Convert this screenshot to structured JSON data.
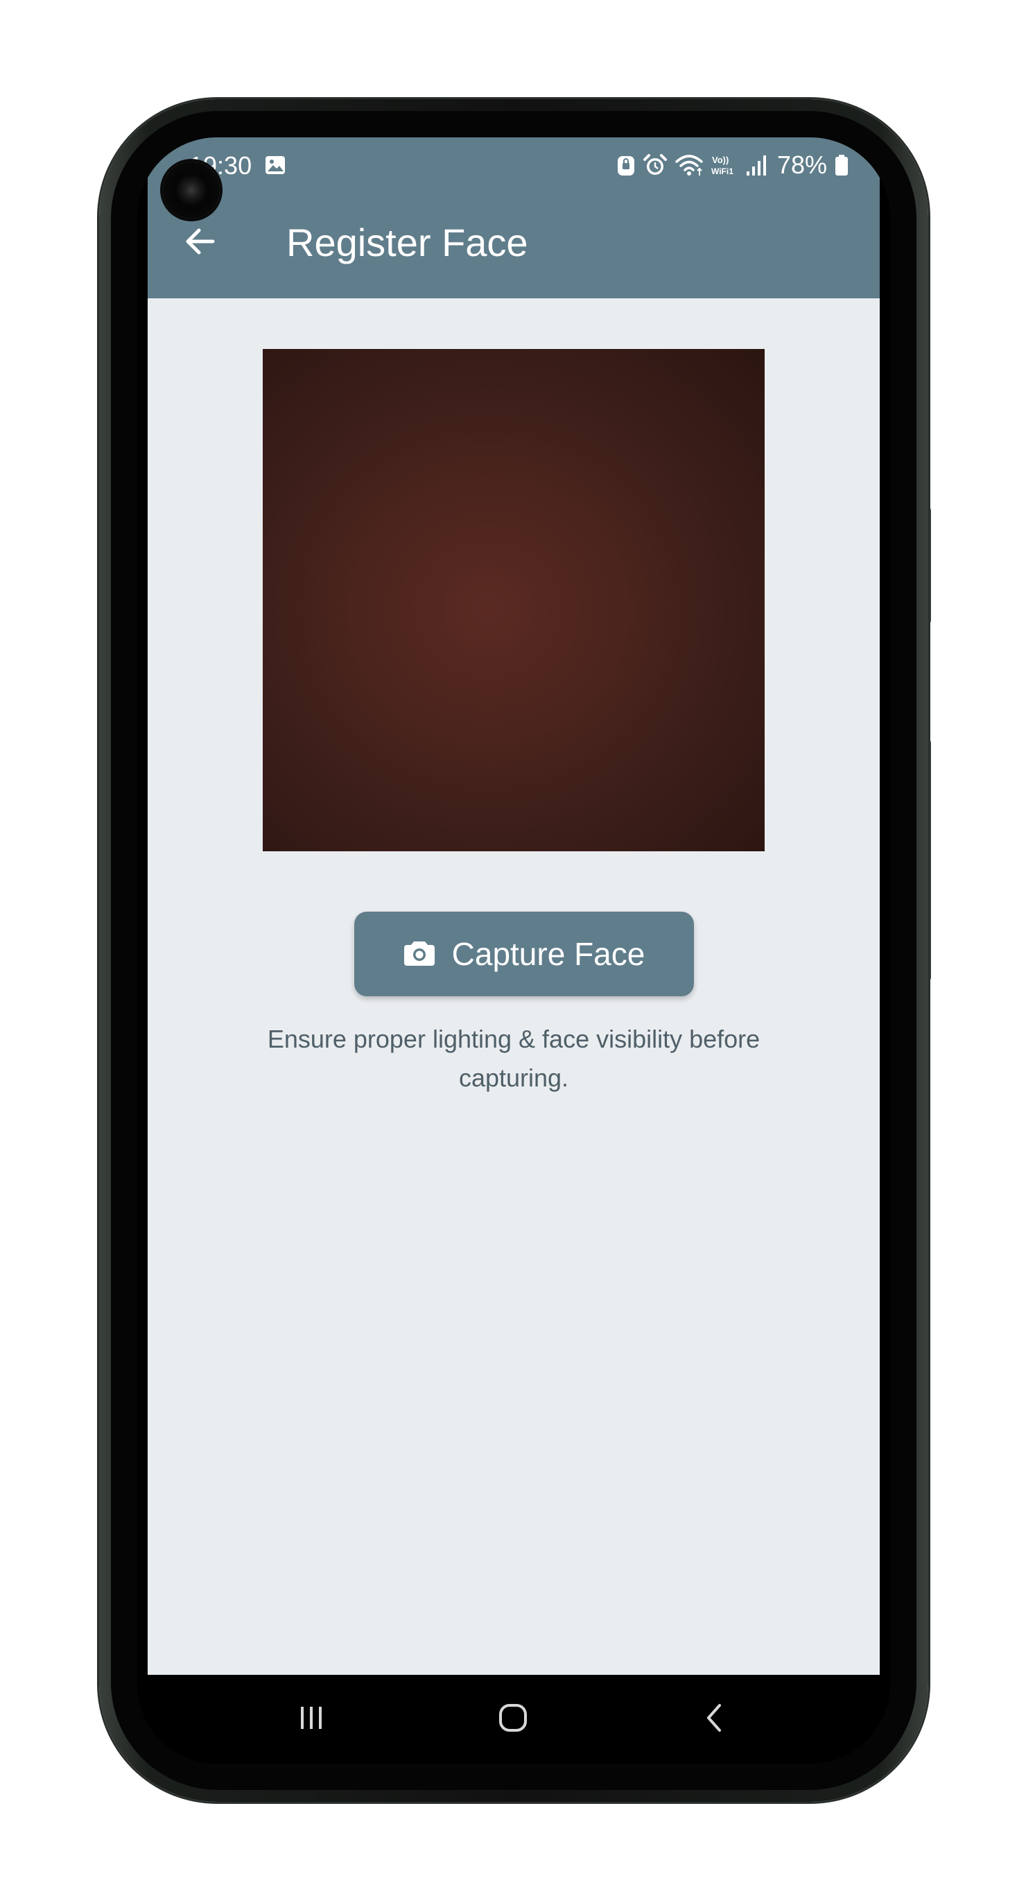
{
  "status_bar": {
    "time": "19:30",
    "battery": "78%",
    "icons": [
      "gallery-icon",
      "vpn-lock-icon",
      "alarm-icon",
      "wifi-icon",
      "volte-wifi-icon",
      "signal-icon",
      "battery-icon"
    ]
  },
  "app_bar": {
    "title": "Register Face",
    "back_icon": "arrow-back-icon"
  },
  "main": {
    "camera_preview": "camera-preview",
    "capture_button_label": "Capture Face",
    "capture_button_icon": "camera-icon",
    "hint_text": "Ensure proper lighting & face visibility before capturing."
  },
  "nav_bar": {
    "buttons": [
      "recent-apps-icon",
      "home-icon",
      "back-icon"
    ]
  },
  "colors": {
    "app_bar": "#607d8b",
    "button": "#607d8b",
    "background": "#eaedf0",
    "hint_text": "#4f5f68"
  }
}
